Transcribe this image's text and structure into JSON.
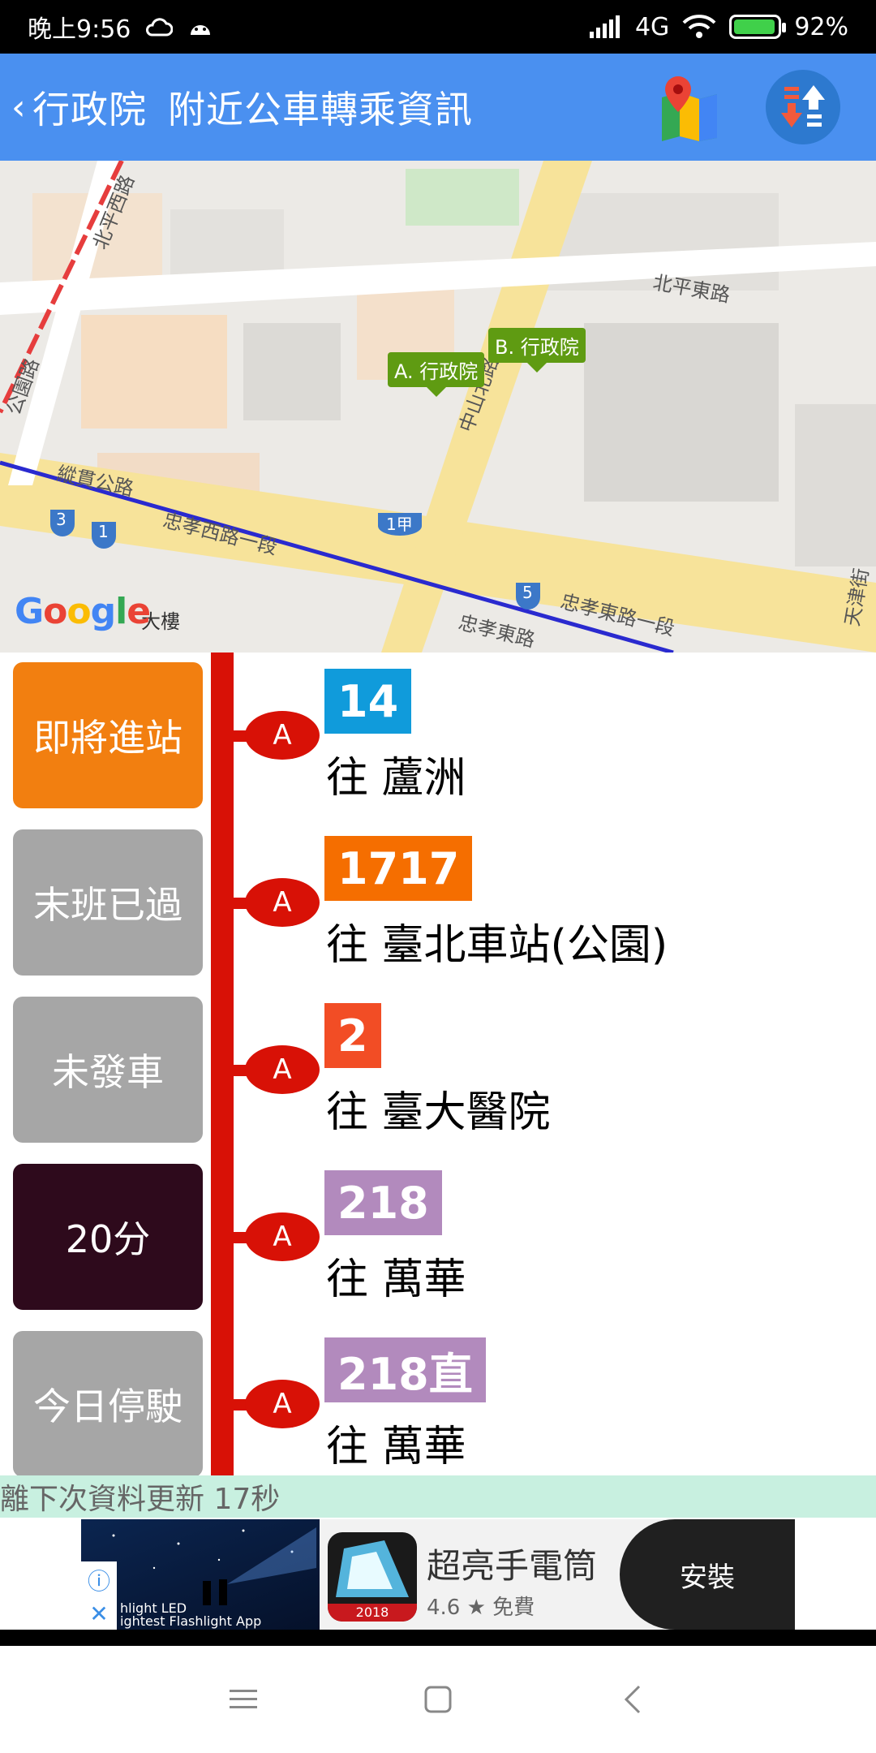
{
  "status_bar": {
    "time": "晚上9:56",
    "network": "4G",
    "battery": "92%",
    "battery_level": 0.92
  },
  "app_bar": {
    "station": "行政院",
    "title": "附近公車轉乘資訊",
    "icons": [
      "back-icon",
      "map-app-icon",
      "sort-refresh-icon"
    ]
  },
  "map": {
    "pins": [
      "A. 行政院",
      "B. 行政院"
    ],
    "labels": {
      "road_beiping_east": "北平東路",
      "road_zhongshan_north": "中山北路",
      "road_zhongxiao_west": "忠孝西路一段",
      "road_zhongxiao_east": "忠孝東路一段",
      "road_zhongxiao_east_short": "忠孝東路",
      "road_zonggui": "縱貫公路",
      "road_park": "公園路",
      "road_beixi": "北平西路",
      "road_tianjin": "天津街",
      "building": "大樓"
    },
    "route_shields": [
      "3",
      "1",
      "1甲",
      "5"
    ],
    "logo": "Google"
  },
  "routes": [
    {
      "status": "即將進站",
      "status_color": "#f27f10",
      "stop": "A",
      "route": "14",
      "route_color": "#109bdb",
      "destination": "往 蘆洲"
    },
    {
      "status": "末班已過",
      "status_color": "#a6a6a6",
      "stop": "A",
      "route": "1717",
      "route_color": "#f56e00",
      "destination": "往 臺北車站(公園)"
    },
    {
      "status": "未發車",
      "status_color": "#a6a6a6",
      "stop": "A",
      "route": "2",
      "route_color": "#f24d25",
      "destination": "往 臺大醫院"
    },
    {
      "status": "20分",
      "status_color": "#2e0a1c",
      "stop": "A",
      "route": "218",
      "route_color": "#b28abd",
      "destination": "往 萬華"
    },
    {
      "status": "今日停駛",
      "status_color": "#a6a6a6",
      "stop": "A",
      "route": "218直",
      "route_color": "#b28abd",
      "destination": "往 萬華"
    }
  ],
  "update_bar": {
    "text": "離下次資料更新 17秒"
  },
  "ad": {
    "image_text_1": "hlight LED",
    "image_text_2": "ightest Flashlight App",
    "app_year": "2018",
    "app_name": "超亮手電筒",
    "rating": "4.6 ★ 免費",
    "install": "安裝",
    "icons": [
      "ad-info-icon",
      "ad-close-icon"
    ]
  },
  "nav": {
    "icons": [
      "menu-icon",
      "home-icon",
      "back-nav-icon"
    ]
  }
}
